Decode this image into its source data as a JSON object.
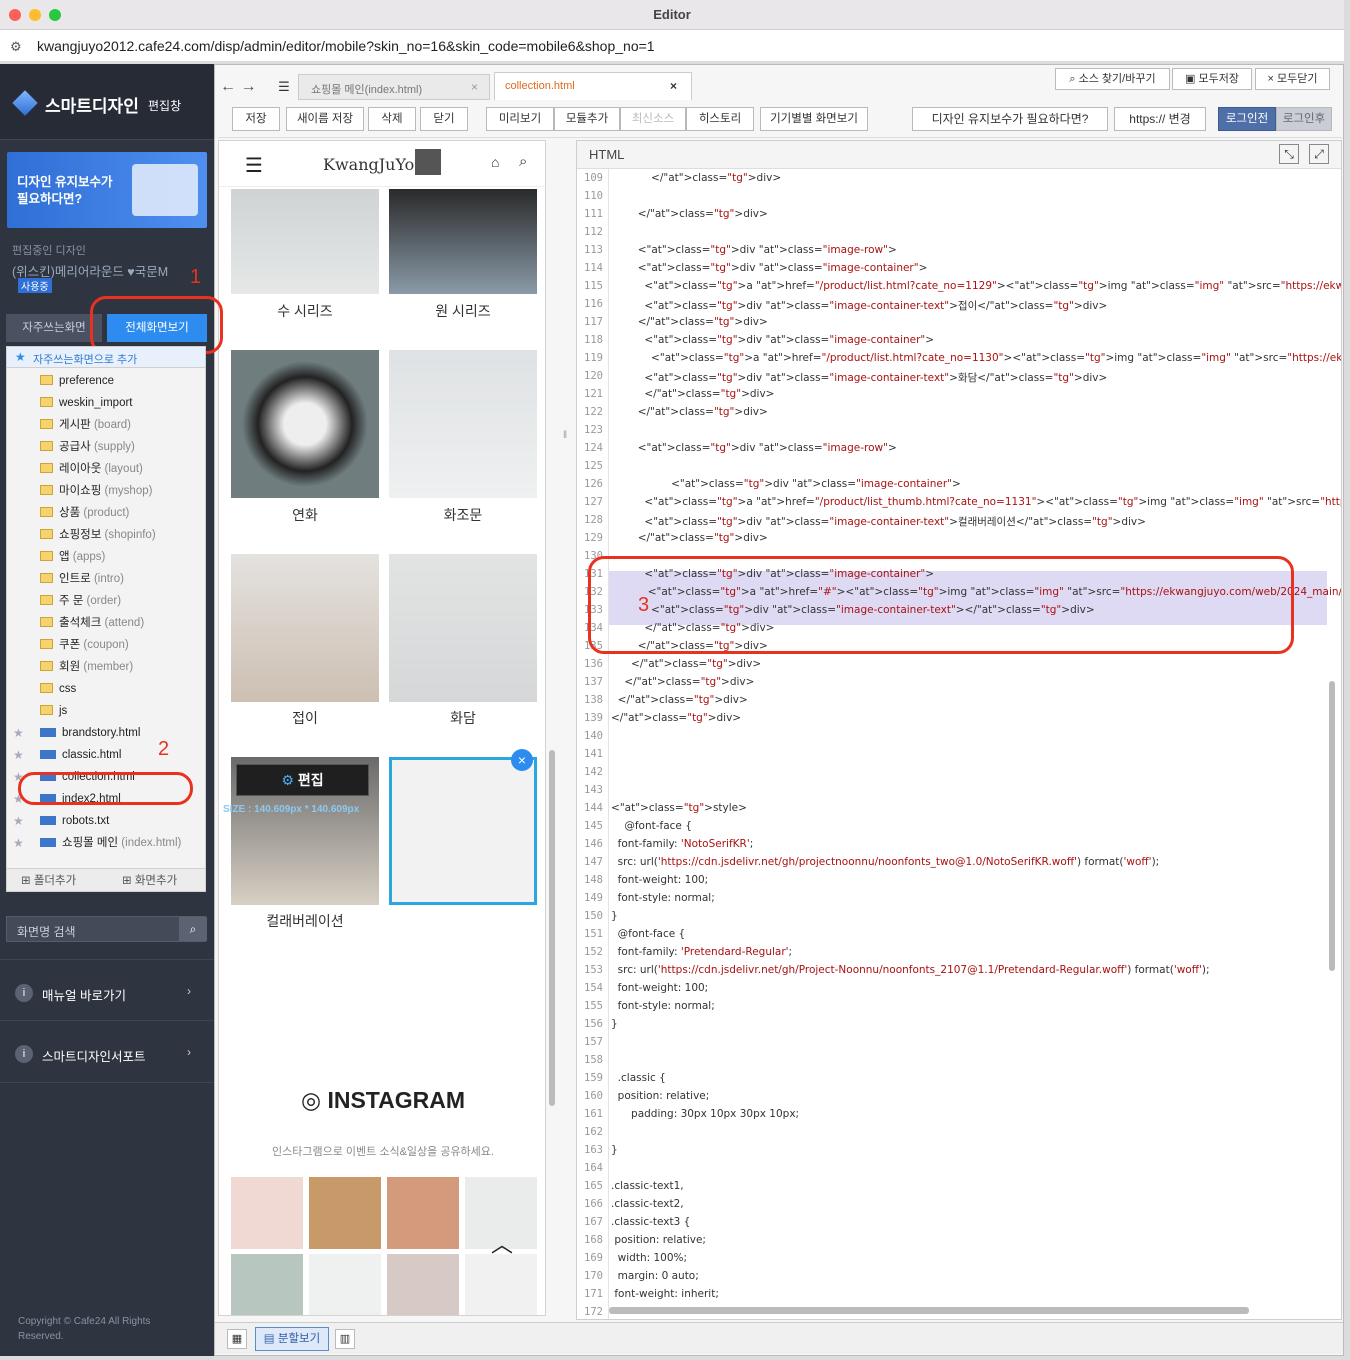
{
  "window": {
    "title": "Editor",
    "url": "kwangjuyo2012.cafe24.com/disp/admin/editor/mobile?skin_no=16&skin_code=mobile6&shop_no=1"
  },
  "sidebar": {
    "brand": "스마트디자인",
    "brand_sub": "편집창",
    "banner": "디자인 유지보수가 필요하다면?",
    "editing_label": "편집중인 디자인",
    "design_name": "(위스킨)메리어라운드 ♥국문M",
    "in_use": "사용중",
    "tabs": [
      "자주쓰는화면",
      "전체화면보기"
    ],
    "add_fav": "자주쓰는화면으로 추가",
    "tree": [
      {
        "label": "preference",
        "kind": "folder"
      },
      {
        "label": "weskin_import",
        "kind": "folder"
      },
      {
        "label": "게시판",
        "sub": "(board)",
        "kind": "folder"
      },
      {
        "label": "공급사",
        "sub": "(supply)",
        "kind": "folder"
      },
      {
        "label": "레이아웃",
        "sub": "(layout)",
        "kind": "folder"
      },
      {
        "label": "마이쇼핑",
        "sub": "(myshop)",
        "kind": "folder"
      },
      {
        "label": "상품",
        "sub": "(product)",
        "kind": "folder"
      },
      {
        "label": "쇼핑정보",
        "sub": "(shopinfo)",
        "kind": "folder"
      },
      {
        "label": "앱",
        "sub": "(apps)",
        "kind": "folder"
      },
      {
        "label": "인트로",
        "sub": "(intro)",
        "kind": "folder"
      },
      {
        "label": "주 문",
        "sub": "(order)",
        "kind": "folder"
      },
      {
        "label": "출석체크",
        "sub": "(attend)",
        "kind": "folder"
      },
      {
        "label": "쿠폰",
        "sub": "(coupon)",
        "kind": "folder"
      },
      {
        "label": "회원",
        "sub": "(member)",
        "kind": "folder"
      },
      {
        "label": "css",
        "kind": "folder"
      },
      {
        "label": "js",
        "kind": "folder"
      },
      {
        "label": "brandstory.html",
        "kind": "file"
      },
      {
        "label": "classic.html",
        "kind": "file"
      },
      {
        "label": "collection.html",
        "kind": "file"
      },
      {
        "label": "index2.html",
        "kind": "file"
      },
      {
        "label": "robots.txt",
        "kind": "file"
      },
      {
        "label": "쇼핑몰 메인",
        "sub": "(index.html)",
        "kind": "file"
      }
    ],
    "add_folder": "폴더추가",
    "add_screen": "화면추가",
    "search_placeholder": "화면명 검색",
    "manual": "매뉴얼 바로가기",
    "support": "스마트디자인서포트",
    "copyright": "Copyright © Cafe24 All Rights Reserved."
  },
  "tabs": {
    "tab1": "쇼핑몰 메인(index.html)",
    "tab2": "collection.html"
  },
  "top_right": {
    "find": "소스 찾기/바꾸기",
    "save_all": "모두저장",
    "close_all": "모두닫기"
  },
  "toolbar": {
    "save": "저장",
    "save_as": "새이름 저장",
    "delete": "삭제",
    "close": "닫기",
    "preview": "미리보기",
    "add_module": "모듈추가",
    "latest": "최신소스",
    "history": "히스토리",
    "device": "기기별별 화면보기",
    "maint": "디자인 유지보수가 필요하다면?",
    "https": "https:// 변경",
    "login_before": "로그인전",
    "login_after": "로그인후"
  },
  "preview": {
    "logo": "KwangJuYo",
    "captions": [
      "수 시리즈",
      "원 시리즈",
      "연화",
      "화조문",
      "접이",
      "화담",
      "컬래버레이션"
    ],
    "edit": "편집",
    "size": "SIZE : 140.609px * 140.609px",
    "instagram": "INSTAGRAM",
    "insta_sub": "인스타그램으로 이벤트 소식&일상을 공유하세요."
  },
  "code": {
    "panel": "HTML",
    "first_line": 109,
    "lines": [
      "            </div>",
      "",
      "        </div>",
      "",
      "        <div class=\"image-row\">",
      "        <div class=\"image-container\">",
      "          <a href=\"/product/list.html?cate_no=1129\"><img class=\"img\" src=\"https://ekwangjuyo.com/web/2024_main/m12.jpg\"></a>",
      "          <div class=\"image-container-text\">접이</div>",
      "        </div>",
      "          <div class=\"image-container\">",
      "            <a href=\"/product/list.html?cate_no=1130\"><img class=\"img\" src=\"https://ekwangjuyo.com/web/2024_main/m13.jpg\"></a>",
      "          <div class=\"image-container-text\">화담</div>",
      "          </div>",
      "        </div>",
      "",
      "        <div class=\"image-row\">",
      "",
      "                  <div class=\"image-container\">",
      "          <a href=\"/product/list_thumb.html?cate_no=1131\"><img class=\"img\" src=\"https://ekwangjuyo.com/web/2024_main/m11.jpg\">",
      "          <div class=\"image-container-text\">컬래버레이션</div>",
      "        </div>",
      "",
      "          <div class=\"image-container\">",
      "           <a href=\"#\"><img class=\"img\" src=\"https://ekwangjuyo.com/web/2024_main/0.png\"> </a>",
      "            <div class=\"image-container-text\"></div>",
      "          </div>",
      "        </div>",
      "      </div>",
      "    </div>",
      "  </div>",
      "</div>",
      "",
      "",
      "",
      "",
      "<style>",
      "    @font-face {",
      "  font-family: 'NotoSerifKR';",
      "  src: url('https://cdn.jsdelivr.net/gh/projectnoonnu/noonfonts_two@1.0/NotoSerifKR.woff') format('woff');",
      "  font-weight: 100;",
      "  font-style: normal;",
      "}",
      "  @font-face {",
      "  font-family: 'Pretendard-Regular';",
      "  src: url('https://cdn.jsdelivr.net/gh/Project-Noonnu/noonfonts_2107@1.1/Pretendard-Regular.woff') format('woff');",
      "  font-weight: 100;",
      "  font-style: normal;",
      "}",
      "",
      "",
      "  .classic {",
      "  position: relative;",
      "      padding: 30px 10px 30px 10px;",
      "",
      "}",
      "",
      ".classic-text1,",
      ".classic-text2,",
      ".classic-text3 {",
      " position: relative;",
      "  width: 100%;",
      "  margin: 0 auto;",
      " font-weight: inherit;",
      ""
    ]
  },
  "annotations": [
    "1",
    "2",
    "3"
  ],
  "bottom": {
    "split": "분할보기"
  }
}
